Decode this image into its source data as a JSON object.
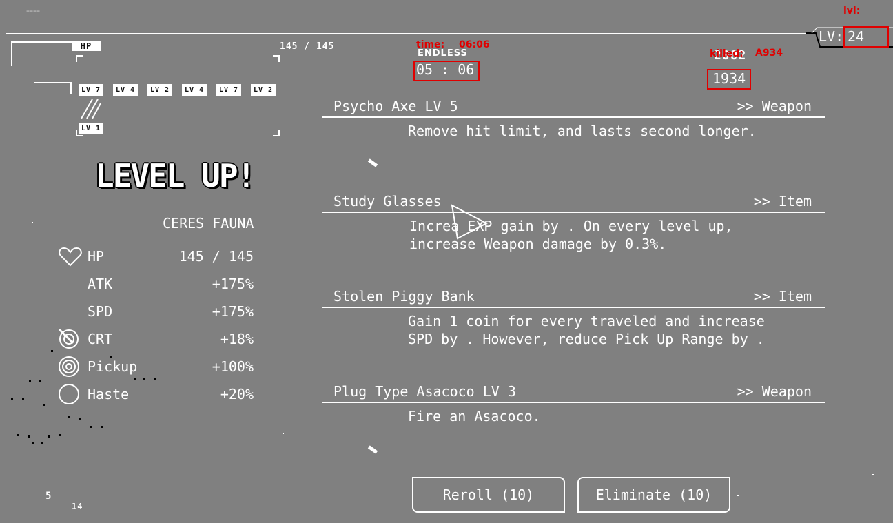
{
  "corner_text": "ｰｰｰｰ",
  "hp_bar": {
    "label": "HP",
    "value": "145 / 145"
  },
  "timer": {
    "mode": "ENDLESS",
    "red_label": "time:",
    "red_value": "06:06",
    "clock": "05 : 06"
  },
  "kills": {
    "overlay_text": "killed:",
    "count_top": "2002",
    "red_value": "A934",
    "count_box": "1934"
  },
  "level": {
    "red_label": "lvl:",
    "label": "LV:",
    "value": "24"
  },
  "weapons": [
    {
      "tag": "LV 7"
    },
    {
      "tag": "LV 4"
    },
    {
      "tag": "LV 2"
    },
    {
      "tag": "LV 4"
    },
    {
      "tag": "LV 7"
    },
    {
      "tag": "LV 2"
    }
  ],
  "item_tag": "LV 1",
  "banner": "LEVEL UP!",
  "character_name": "CERES FAUNA",
  "stats": [
    {
      "icon": "heart-icon",
      "label": "HP",
      "value": "145 / 145"
    },
    {
      "icon": "",
      "label": "ATK",
      "value": "+175%"
    },
    {
      "icon": "",
      "label": "SPD",
      "value": "+175%"
    },
    {
      "icon": "crt-icon",
      "label": "CRT",
      "value": "+18%"
    },
    {
      "icon": "pickup-icon",
      "label": "Pickup",
      "value": "+100%"
    },
    {
      "icon": "haste-icon",
      "label": "Haste",
      "value": "+20%"
    }
  ],
  "cards": [
    {
      "title": "Psycho Axe LV 5",
      "kind": ">> Weapon",
      "lines": [
        "Remove hit limit, and lasts   second longer."
      ]
    },
    {
      "title": "Study Glasses",
      "kind": ">> Item",
      "lines": [
        "Increa   EXP gain by    . On every level up,",
        "increase Weapon damage by 0.3%."
      ]
    },
    {
      "title": "Stolen Piggy Bank",
      "kind": ">> Item",
      "lines": [
        "Gain 1 coin for every       traveled and increase",
        "SPD by    . However, reduce Pick Up Range by    ."
      ]
    },
    {
      "title": "Plug Type Asacoco LV 3",
      "kind": ">> Weapon",
      "lines": [
        "Fire an             Asacoco."
      ]
    }
  ],
  "buttons": {
    "reroll": "Reroll (10)",
    "eliminate": "Eliminate (10)"
  },
  "bottom_left": {
    "a": "5",
    "b": "14"
  }
}
